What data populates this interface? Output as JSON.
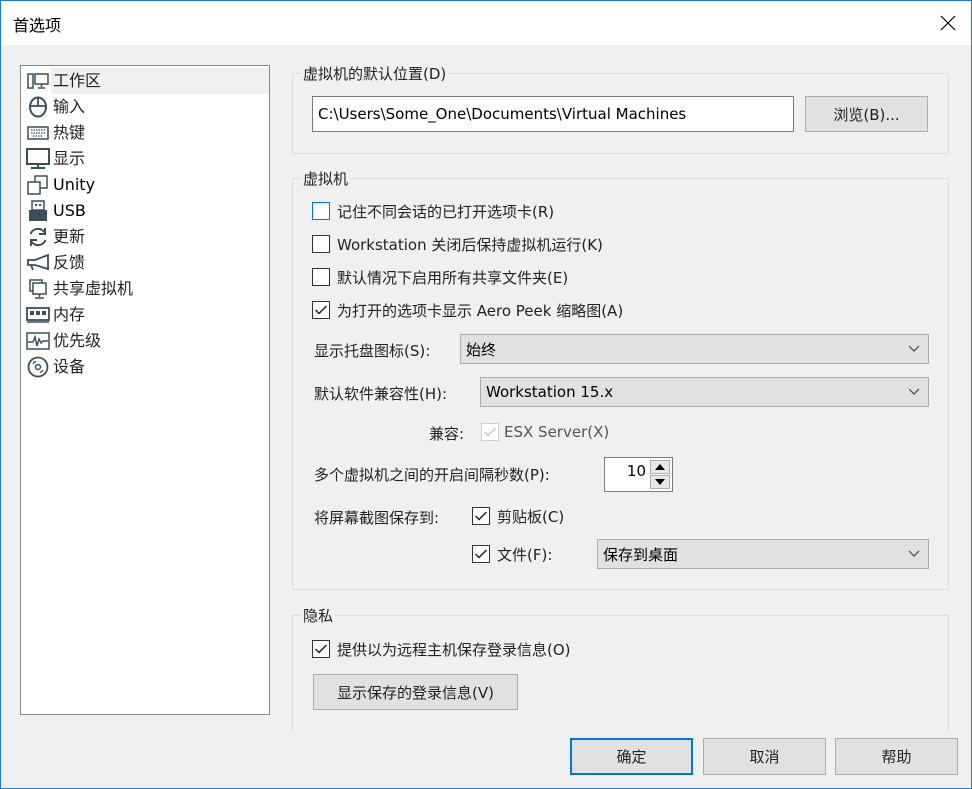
{
  "window": {
    "title": "首选项"
  },
  "sidebar": {
    "items": [
      {
        "label": "工作区",
        "icon": "workspace-icon",
        "selected": true
      },
      {
        "label": "输入",
        "icon": "mouse-icon"
      },
      {
        "label": "热键",
        "icon": "keyboard-icon"
      },
      {
        "label": "显示",
        "icon": "monitor-icon"
      },
      {
        "label": "Unity",
        "icon": "unity-windows-icon"
      },
      {
        "label": "USB",
        "icon": "usb-icon"
      },
      {
        "label": "更新",
        "icon": "refresh-icon"
      },
      {
        "label": "反馈",
        "icon": "megaphone-icon"
      },
      {
        "label": "共享虚拟机",
        "icon": "shared-vm-icon"
      },
      {
        "label": "内存",
        "icon": "memory-icon"
      },
      {
        "label": "优先级",
        "icon": "priority-pulse-icon"
      },
      {
        "label": "设备",
        "icon": "disc-icon"
      }
    ]
  },
  "default_location": {
    "group_title": "虚拟机的默认位置(D)",
    "path_value": "C:\\Users\\Some_One\\Documents\\Virtual Machines",
    "browse_label": "浏览(B)..."
  },
  "vm": {
    "group_title": "虚拟机",
    "remember_tabs": {
      "label": "记住不同会话的已打开选项卡(R)",
      "checked": false
    },
    "keep_running": {
      "label": "Workstation 关闭后保持虚拟机运行(K)",
      "checked": false
    },
    "enable_shared_folders": {
      "label": "默认情况下启用所有共享文件夹(E)",
      "checked": false
    },
    "aero_peek": {
      "label": "为打开的选项卡显示 Aero Peek 缩略图(A)",
      "checked": true
    },
    "tray_icon_label": "显示托盘图标(S):",
    "tray_icon_value": "始终",
    "compat_label": "默认软件兼容性(H):",
    "compat_value": "Workstation 15.x",
    "compatible_label": "兼容:",
    "esx_label": "ESX Server(X)",
    "esx_checked": true,
    "interval_label": "多个虚拟机之间的开启间隔秒数(P):",
    "interval_value": "10",
    "screenshot_label": "将屏幕截图保存到:",
    "clipboard": {
      "label": "剪贴板(C)",
      "checked": true
    },
    "file": {
      "label": "文件(F):",
      "checked": true
    },
    "file_dest_value": "保存到桌面"
  },
  "privacy": {
    "group_title": "隐私",
    "save_login": {
      "label": "提供以为远程主机保存登录信息(O)",
      "checked": true
    },
    "show_saved_label": "显示保存的登录信息(V)"
  },
  "footer": {
    "ok_label": "确定",
    "cancel_label": "取消",
    "help_label": "帮助"
  },
  "colors": {
    "accent": "#0078d7",
    "window_border": "#1979ca",
    "background": "#f0f0f0",
    "icon": "#3c4e5a"
  }
}
